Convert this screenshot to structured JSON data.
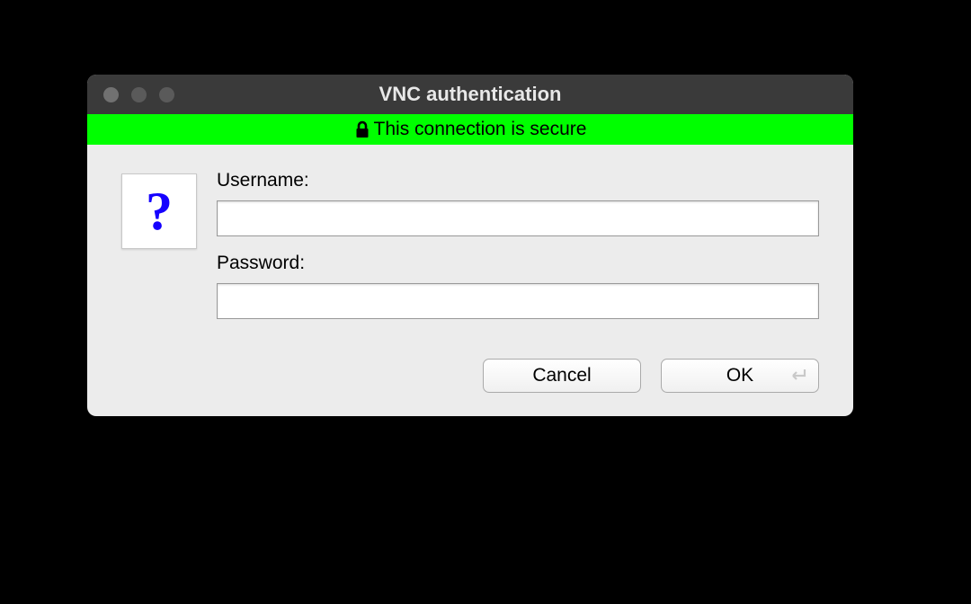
{
  "title": "VNC authentication",
  "banner": {
    "text": "This connection is secure"
  },
  "question_glyph": "?",
  "fields": {
    "username_label": "Username:",
    "username_value": "",
    "password_label": "Password:",
    "password_value": ""
  },
  "buttons": {
    "cancel_label": "Cancel",
    "ok_label": "OK"
  },
  "colors": {
    "banner_bg": "#00ff00",
    "question_color": "#1500ff"
  }
}
